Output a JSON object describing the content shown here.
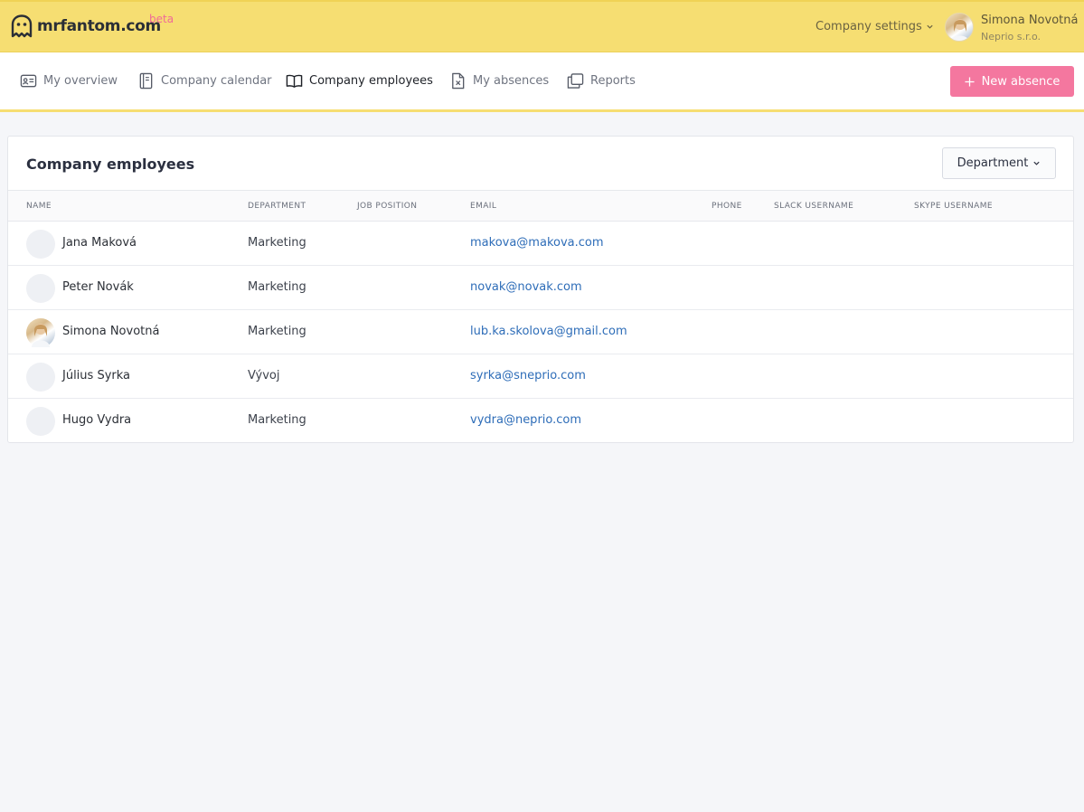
{
  "header": {
    "logo_text": "mrfantom.com",
    "beta": "beta",
    "company_settings": "Company settings",
    "user_name": "Simona Novotná",
    "user_company": "Neprio s.r.o."
  },
  "nav": {
    "items": [
      {
        "label": "My overview",
        "icon": "id-card-icon"
      },
      {
        "label": "Company calendar",
        "icon": "notebook-icon"
      },
      {
        "label": "Company employees",
        "icon": "open-book-icon",
        "active": true
      },
      {
        "label": "My absences",
        "icon": "file-x-icon"
      },
      {
        "label": "Reports",
        "icon": "folders-icon"
      }
    ],
    "new_absence": "New absence"
  },
  "card": {
    "title": "Company employees",
    "department_button": "Department"
  },
  "table": {
    "columns": [
      "NAME",
      "DEPARTMENT",
      "JOB POSITION",
      "EMAIL",
      "PHONE",
      "SLACK USERNAME",
      "SKYPE USERNAME"
    ],
    "rows": [
      {
        "name": "Jana Maková",
        "department": "Marketing",
        "email": "makova@makova.com"
      },
      {
        "name": "Peter Novák",
        "department": "Marketing",
        "email": "novak@novak.com"
      },
      {
        "name": "Simona Novotná",
        "department": "Marketing",
        "email": "lub.ka.skolova@gmail.com"
      },
      {
        "name": "Július Syrka",
        "department": "Vývoj",
        "email": "syrka@sneprio.com"
      },
      {
        "name": "Hugo Vydra",
        "department": "Marketing",
        "email": "vydra@neprio.com"
      }
    ]
  },
  "colors": {
    "topbar": "#f6de72",
    "accent_pink": "#f4779f",
    "link_blue": "#2e6db8"
  }
}
